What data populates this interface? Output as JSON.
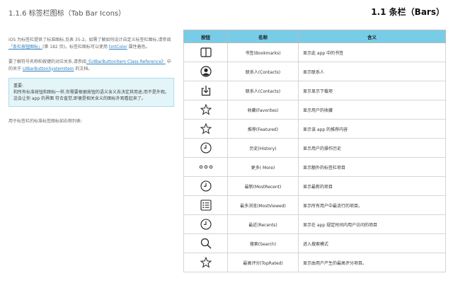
{
  "header": {
    "section_title": "1.1.6   标签栏图标（Tab Bar Icons）",
    "chapter_title": "1.1   条栏（Bars）"
  },
  "intro": {
    "p1_a": "iOS 为标签栏提供了标准图标,见表 35-2。如需了解如何设计自定义标签栏图标,请参阅",
    "p1_link": "「条栏按钮图标」",
    "p1_b": "(第 182 页)。标签栏图标可以使用",
    "p1_link2": "tintColor",
    "p1_c": "属性着色。",
    "p2_a": "要了解符号名称和按键的对应关系,请参阅",
    "p2_link": "《UIBarButtonItem Class Reference》",
    "p2_b": "中的关于",
    "p2_link2": "UIBarButtonSystemItem",
    "p2_c": "的文档。",
    "note_title": "重要:",
    "note_body": "和所有标准按钮和图标一样,你需要根据按钮的语义含义去决定其用途,而不是外观。这会让你 app 的界面 符合直觉,即便是相关含义的图标外观看起来了。",
    "p3": "用于标签栏的标准标签图标如右侧列表:"
  },
  "table": {
    "headers": [
      "按钮",
      "名称",
      "含义"
    ],
    "rows": [
      {
        "icon": "book-icon",
        "name": "书签(Bookmarks)",
        "desc": "显示此 app 中的书签"
      },
      {
        "icon": "contact-icon",
        "name": "联系人(Contacts)",
        "desc": "显示联系人"
      },
      {
        "icon": "download-icon",
        "name": "联系人(Contacts)",
        "desc": "显示显示下载项"
      },
      {
        "icon": "star-icon",
        "name": "收藏(Favorites)",
        "desc": "显示用户的收藏"
      },
      {
        "icon": "star-icon",
        "name": "推荐(Featured)",
        "desc": "显示该 app 的推荐内容"
      },
      {
        "icon": "clock-icon",
        "name": "历史(History)",
        "desc": "显示用户的操作历史"
      },
      {
        "icon": "more-icon",
        "name": "更多( More)",
        "desc": "显示额外的标签栏项目"
      },
      {
        "icon": "clock-icon",
        "name": "最新(MostRecent)",
        "desc": "显示最新的项目"
      },
      {
        "icon": "list-icon",
        "name": "最多浏览(MostViewed)",
        "desc": "显示所有用户中最流行的项目。"
      },
      {
        "icon": "clock-icon",
        "name": "最近(Recents)",
        "desc": "显示在 app 规定时间内用户访问的项目"
      },
      {
        "icon": "search-icon",
        "name": "搜索(Search)",
        "desc": "进入搜索模式"
      },
      {
        "icon": "star-icon",
        "name": "最高评分(TopRated)",
        "desc": "显示由用户产生的最高评分项目。"
      }
    ]
  },
  "colors": {
    "header_bg": "#77cde8",
    "note_bg": "#e4f5fa",
    "link": "#2d7fc1"
  }
}
